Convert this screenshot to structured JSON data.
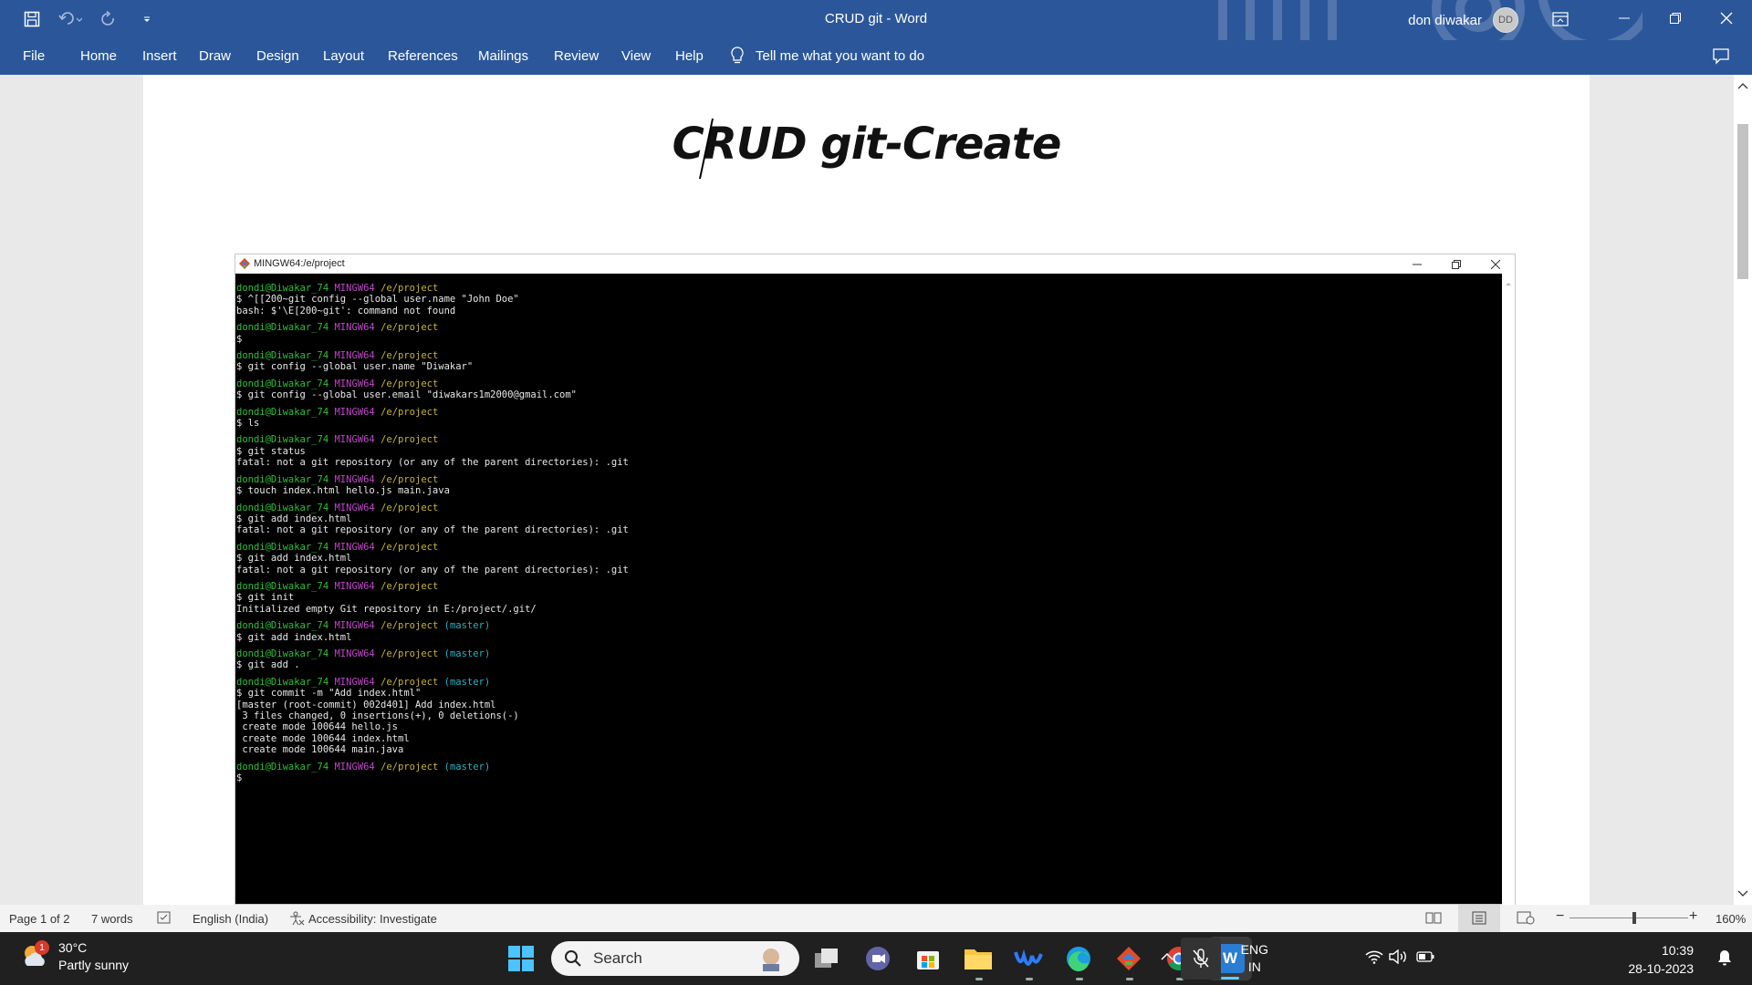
{
  "window": {
    "title": "CRUD git  -  Word"
  },
  "user": {
    "name": "don diwakar",
    "initials": "DD"
  },
  "menu": {
    "tabs": [
      "File",
      "Home",
      "Insert",
      "Draw",
      "Design",
      "Layout",
      "References",
      "Mailings",
      "Review",
      "View",
      "Help"
    ],
    "tell_me": "Tell me what you want to do"
  },
  "document": {
    "heading": "CRUD git-Create",
    "terminal": {
      "title": "MINGW64:/e/project",
      "blocks": [
        {
          "user": "dondi@Diwakar_74",
          "host": "MINGW64",
          "path": "/e/project",
          "branch": "",
          "lines": [
            "$ ^[[200~git config --global user.name \"John Doe\"",
            "bash: $'\\E[200~git': command not found"
          ]
        },
        {
          "user": "dondi@Diwakar_74",
          "host": "MINGW64",
          "path": "/e/project",
          "branch": "",
          "lines": [
            "$"
          ]
        },
        {
          "user": "dondi@Diwakar_74",
          "host": "MINGW64",
          "path": "/e/project",
          "branch": "",
          "lines": [
            "$ git config --global user.name \"Diwakar\""
          ]
        },
        {
          "user": "dondi@Diwakar_74",
          "host": "MINGW64",
          "path": "/e/project",
          "branch": "",
          "lines": [
            "$ git config --global user.email \"diwakars1m2000@gmail.com\""
          ]
        },
        {
          "user": "dondi@Diwakar_74",
          "host": "MINGW64",
          "path": "/e/project",
          "branch": "",
          "lines": [
            "$ ls"
          ]
        },
        {
          "user": "dondi@Diwakar_74",
          "host": "MINGW64",
          "path": "/e/project",
          "branch": "",
          "lines": [
            "$ git status",
            "fatal: not a git repository (or any of the parent directories): .git"
          ]
        },
        {
          "user": "dondi@Diwakar_74",
          "host": "MINGW64",
          "path": "/e/project",
          "branch": "",
          "lines": [
            "$ touch index.html hello.js main.java"
          ]
        },
        {
          "user": "dondi@Diwakar_74",
          "host": "MINGW64",
          "path": "/e/project",
          "branch": "",
          "lines": [
            "$ git add index.html",
            "fatal: not a git repository (or any of the parent directories): .git"
          ]
        },
        {
          "user": "dondi@Diwakar_74",
          "host": "MINGW64",
          "path": "/e/project",
          "branch": "",
          "lines": [
            "$ git add index.html",
            "fatal: not a git repository (or any of the parent directories): .git"
          ]
        },
        {
          "user": "dondi@Diwakar_74",
          "host": "MINGW64",
          "path": "/e/project",
          "branch": "",
          "lines": [
            "$ git init",
            "Initialized empty Git repository in E:/project/.git/"
          ]
        },
        {
          "user": "dondi@Diwakar_74",
          "host": "MINGW64",
          "path": "/e/project",
          "branch": "(master)",
          "lines": [
            "$ git add index.html"
          ]
        },
        {
          "user": "dondi@Diwakar_74",
          "host": "MINGW64",
          "path": "/e/project",
          "branch": "(master)",
          "lines": [
            "$ git add ."
          ]
        },
        {
          "user": "dondi@Diwakar_74",
          "host": "MINGW64",
          "path": "/e/project",
          "branch": "(master)",
          "lines": [
            "$ git commit -m \"Add index.html\"",
            "[master (root-commit) 002d401] Add index.html",
            " 3 files changed, 0 insertions(+), 0 deletions(-)",
            " create mode 100644 hello.js",
            " create mode 100644 index.html",
            " create mode 100644 main.java"
          ]
        },
        {
          "user": "dondi@Diwakar_74",
          "host": "MINGW64",
          "path": "/e/project",
          "branch": "(master)",
          "lines": [
            "$"
          ]
        }
      ]
    }
  },
  "status": {
    "page": "Page 1 of 2",
    "words": "7 words",
    "language": "English (India)",
    "accessibility": "Accessibility: Investigate",
    "zoom": "160%",
    "zoom_minus": "−",
    "zoom_plus": "+"
  },
  "taskbar": {
    "weather_temp": "30°C",
    "weather_desc": "Partly sunny",
    "weather_badge": "1",
    "search_placeholder": "Search",
    "lang_top": "ENG",
    "lang_bottom": "IN",
    "time": "10:39",
    "date": "28-10-2023",
    "word_letter": "W"
  },
  "colors": {
    "word_blue": "#2b579a",
    "taskbar": "#202020",
    "terminal_bg": "#000000"
  }
}
